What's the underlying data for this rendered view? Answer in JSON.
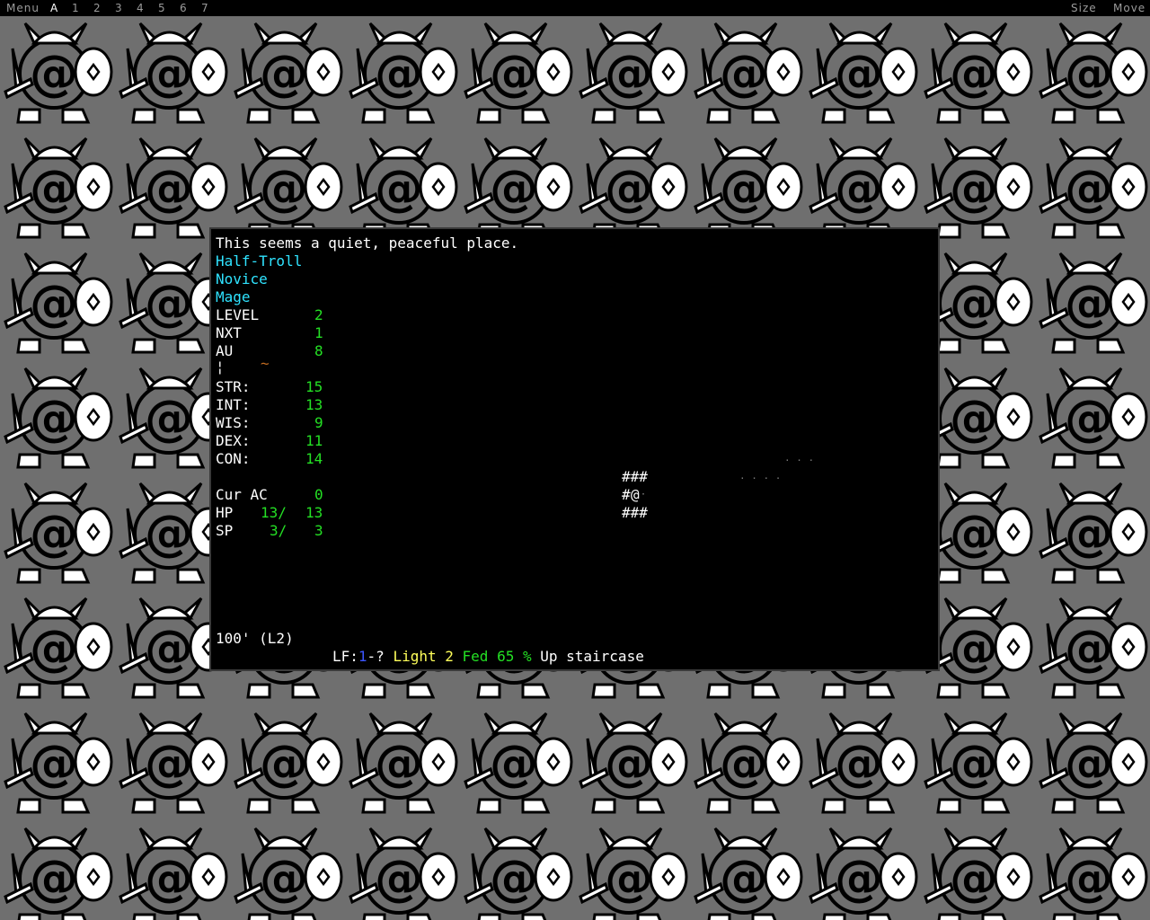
{
  "menubar": {
    "left_items": [
      "Menu",
      "A",
      "1",
      "2",
      "3",
      "4",
      "5",
      "6",
      "7"
    ],
    "active_item": "A",
    "right_items": [
      "Size",
      "Move"
    ]
  },
  "game": {
    "message": "This seems a quiet, peaceful place.",
    "race": "Half-Troll",
    "title": "Novice",
    "class": "Mage",
    "stats_top": [
      {
        "label": "LEVEL",
        "value": "2"
      },
      {
        "label": "NXT",
        "value": "1"
      },
      {
        "label": "AU",
        "value": "8"
      }
    ],
    "equip_row": {
      "left": "¦",
      "right": "~"
    },
    "attributes": [
      {
        "label": "STR:",
        "value": "15"
      },
      {
        "label": "INT:",
        "value": "13"
      },
      {
        "label": "WIS:",
        "value": "9"
      },
      {
        "label": "DEX:",
        "value": "11"
      },
      {
        "label": "CON:",
        "value": "14"
      }
    ],
    "ac": {
      "label": "Cur AC",
      "value": "0"
    },
    "hp": {
      "label": "HP",
      "cur": "13/",
      "max": "13"
    },
    "sp": {
      "label": "SP",
      "cur": "3/",
      "max": "3"
    },
    "depth": "100' (L2)",
    "status": {
      "lf_label": "LF:",
      "lf_level": "1",
      "lf_rest": "-?",
      "light": "Light 2",
      "fed": "Fed 65 %",
      "location": "Up staircase"
    },
    "map": {
      "row1": "###",
      "row2_wall": "#",
      "player": "@",
      "row2_floor": "·",
      "row3": "###",
      "dots_a": "· · ·",
      "dots_b": "· · · ·"
    }
  },
  "colors": {
    "wallpaper_bg": "#6f6f6f",
    "race_class": "#2fe3ff",
    "stat_value": "#24e024",
    "light": "#ffff5a",
    "fed": "#24e024"
  }
}
